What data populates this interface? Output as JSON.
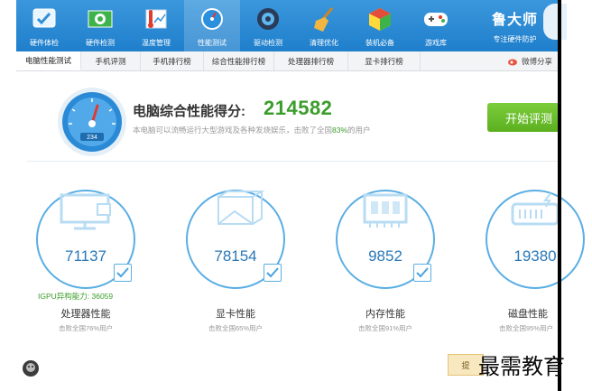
{
  "toolbar": {
    "items": [
      {
        "label": "硬件体检",
        "icon": "hardware-check-icon"
      },
      {
        "label": "硬件检测",
        "icon": "hardware-detect-icon"
      },
      {
        "label": "温度管理",
        "icon": "temperature-icon"
      },
      {
        "label": "性能测试",
        "icon": "gauge-icon",
        "active": true
      },
      {
        "label": "驱动检测",
        "icon": "driver-icon"
      },
      {
        "label": "清理优化",
        "icon": "broom-icon"
      },
      {
        "label": "装机必备",
        "icon": "package-icon"
      },
      {
        "label": "游戏库",
        "icon": "gamepad-icon"
      }
    ],
    "brand_name": "鲁大师",
    "brand_slogan": "专注硬件防护"
  },
  "tabs": [
    {
      "label": "电脑性能测试",
      "active": true
    },
    {
      "label": "手机评测"
    },
    {
      "label": "手机排行榜"
    },
    {
      "label": "综合性能排行榜"
    },
    {
      "label": "处理器排行榜"
    },
    {
      "label": "显卡排行榜"
    }
  ],
  "share_label": "微博分享",
  "score": {
    "title": "电脑综合性能得分:",
    "value": "214582",
    "gauge_text": "234",
    "subtitle_pre": "本电脑可以流畅运行大型游戏及各种发烧娱乐，击败了全国",
    "subtitle_pct": "83%",
    "subtitle_post": "的用户"
  },
  "start_button": "开始评测",
  "components": [
    {
      "value": "71137",
      "name": "处理器性能",
      "beat": "击败全国76%用户",
      "icon": "monitor-icon"
    },
    {
      "value": "78154",
      "name": "显卡性能",
      "beat": "击败全国65%用户",
      "icon": "graphics-cube-icon"
    },
    {
      "value": "9852",
      "name": "内存性能",
      "beat": "击败全国91%用户",
      "icon": "memory-chip-icon"
    },
    {
      "value": "19380",
      "name": "磁盘性能",
      "beat": "击败全国95%用户",
      "icon": "disk-icon"
    }
  ],
  "igpu_label": "IGPU异构能力: 36059",
  "promo_label": "提",
  "watermark": "最需教育",
  "colors": {
    "brand_blue": "#2587d2",
    "accent_green": "#3a9d2a",
    "ring_blue": "#5aaee4"
  }
}
